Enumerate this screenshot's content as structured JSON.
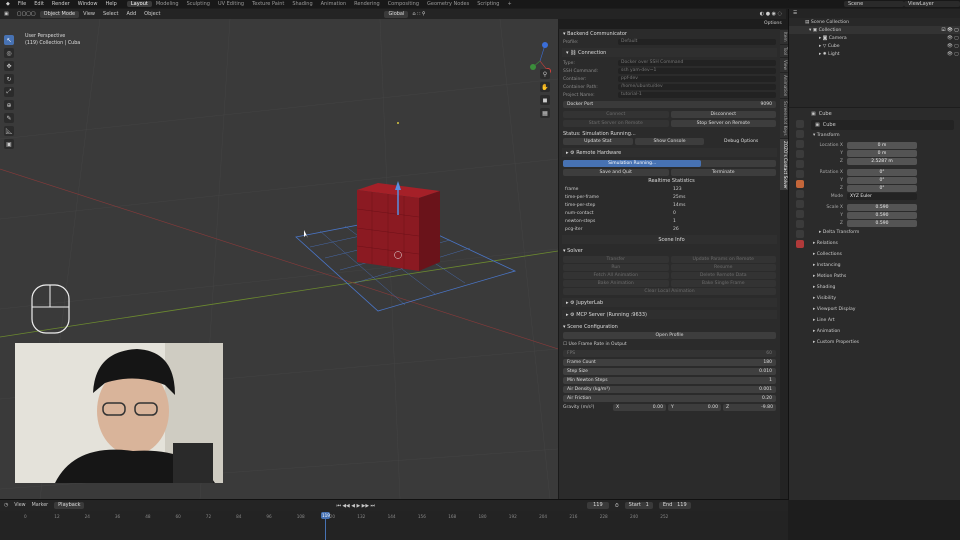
{
  "topbar": {
    "menus": [
      "File",
      "Edit",
      "Render",
      "Window",
      "Help"
    ],
    "workspaces": [
      "Layout",
      "Modeling",
      "Sculpting",
      "UV Editing",
      "Texture Paint",
      "Shading",
      "Animation",
      "Rendering",
      "Compositing",
      "Geometry Nodes",
      "Scripting"
    ],
    "active_workspace": "Layout",
    "add_tab": "+",
    "scene_label": "Scene",
    "viewlayer_label": "ViewLayer"
  },
  "header3d": {
    "mode": "Object Mode",
    "menus": [
      "View",
      "Select",
      "Add",
      "Object"
    ],
    "orientation": "Global",
    "options": "Options"
  },
  "viewport": {
    "view_name": "User Perspective",
    "collection_info": "(119) Collection | Cuba"
  },
  "npanel": {
    "addon_title": "Backend Communicator",
    "profile_label": "Profile:",
    "profile_value": "Default",
    "connection_title": "Connection",
    "fields": [
      {
        "label": "Type:",
        "value": "Docker over SSH Command"
      },
      {
        "label": "SSH Command:",
        "value": "ssh yam-dev~1"
      },
      {
        "label": "Container:",
        "value": "ppf-dev"
      },
      {
        "label": "Container Path:",
        "value": "/home/ubuntu/dev"
      },
      {
        "label": "Project Name:",
        "value": "tutorial-1"
      }
    ],
    "docker_port_label": "Docker Port",
    "docker_port_value": "9090",
    "connect": "Connect",
    "disconnect": "Disconnect",
    "start_server": "Start Server on Remote",
    "stop_server": "Stop Server on Remote",
    "status": "Status: Simulation Running...",
    "update_status": "Update Stat",
    "show_console": "Show Console",
    "debug_options": "Debug Options",
    "remote_hardware": "Remote Hardware",
    "progress_label": "Simulation Running...",
    "progress_fraction": 0.65,
    "save_and_quit": "Save and Quit",
    "terminate": "Terminate",
    "realtime_stats": "Realtime Statistics",
    "stats": [
      {
        "k": "frame",
        "v": "123"
      },
      {
        "k": "time-per-frame",
        "v": "25ms"
      },
      {
        "k": "time-per-step",
        "v": "14ms"
      },
      {
        "k": "num-contact",
        "v": "0"
      },
      {
        "k": "newton-steps",
        "v": "1"
      },
      {
        "k": "pcg-iter",
        "v": "26"
      }
    ],
    "scene_info": "Scene Info",
    "solver_title": "Solver",
    "solver_buttons": [
      [
        "Transfer",
        "Update Params on Remote"
      ],
      [
        "Run",
        "Resume"
      ],
      [
        "Fetch All Animation",
        "Delete Remote Data"
      ],
      [
        "Bake Animation",
        "Bake Single Frame"
      ]
    ],
    "clear_local": "Clear Local Animation",
    "jupyterlab": "JupyterLab",
    "mcp_server": "MCP Server (Running :9633)",
    "scene_config_title": "Scene Configuration",
    "open_profile": "Open Profile",
    "use_frame_rate": "Use Frame Rate in Output",
    "fps_label": "FPS",
    "fps_value": "60",
    "frame_count_label": "Frame Count",
    "frame_count_value": "180",
    "step_size_label": "Step Size",
    "step_size_value": "0.010",
    "min_newton_label": "Min Newton Steps",
    "min_newton_value": "1",
    "air_density_label": "Air Density (kg/m³)",
    "air_density_value": "0.001",
    "air_friction_label": "Air Friction",
    "air_friction_value": "0.20",
    "gravity_label": "Gravity (m/s²)",
    "gravity": {
      "x": "0.00",
      "y": "0.00",
      "z": "-9.80"
    }
  },
  "vtabs": [
    "Item",
    "Tool",
    "View",
    "Animation",
    "Screenshot Keys",
    "ZOZO's Contact Solver"
  ],
  "outliner": {
    "title": "Scene Collection",
    "items": [
      {
        "name": "Collection",
        "level": 1
      },
      {
        "name": "Camera",
        "level": 2
      },
      {
        "name": "Cube",
        "level": 2
      },
      {
        "name": "Light",
        "level": 2
      }
    ]
  },
  "properties": {
    "object_name": "Cube",
    "data_name": "Cube",
    "transform_title": "Transform",
    "location": {
      "label": "Location X",
      "x": "0 m",
      "y": "0 m",
      "z": "2.5287 m"
    },
    "rotation": {
      "label": "Rotation X",
      "x": "0°",
      "y": "0°",
      "z": "0°"
    },
    "mode_label": "Mode",
    "mode_value": "XYZ Euler",
    "scale": {
      "label": "Scale X",
      "x": "0.590",
      "y": "0.590",
      "z": "0.590"
    },
    "delta_transform": "Delta Transform",
    "sections": [
      "Relations",
      "Collections",
      "Instancing",
      "Motion Paths",
      "Shading",
      "Visibility",
      "Viewport Display",
      "Line Art",
      "Animation",
      "Custom Properties"
    ]
  },
  "timeline": {
    "menus": [
      "View",
      "Marker",
      "Playback"
    ],
    "current_frame": "119",
    "start_label": "Start",
    "start_value": "1",
    "end_label": "End",
    "end_value": "119",
    "ticks": [
      "0",
      "12",
      "24",
      "36",
      "48",
      "60",
      "72",
      "84",
      "96",
      "108",
      "120",
      "132",
      "144",
      "156",
      "168",
      "180",
      "192",
      "204",
      "216",
      "228",
      "240",
      "252"
    ],
    "playhead_label": "119"
  },
  "colors": {
    "accent": "#4772b3",
    "cube": "#8b1a22",
    "viewport_bg": "#3a3a3a",
    "panel_bg": "#2b2b2b",
    "progress": "#4772b3",
    "playhead": "#4772b3"
  }
}
